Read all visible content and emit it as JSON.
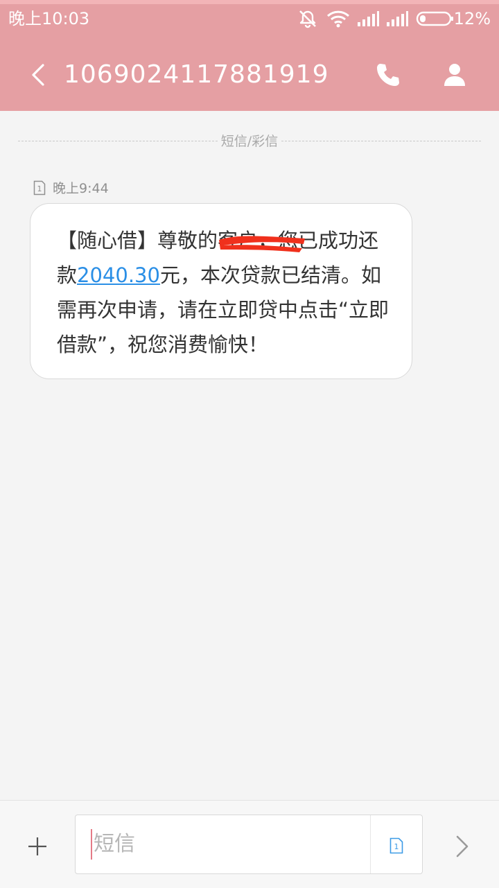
{
  "status_bar": {
    "time": "晚上10:03",
    "battery_percent": "12%"
  },
  "header": {
    "title": "1069024117881919"
  },
  "divider": {
    "label": "短信/彩信"
  },
  "message": {
    "time": "晚上9:44",
    "sim_slot": "1",
    "text_before_amount": "【随心借】尊敬的客户，您已成功还款",
    "amount": "2040.30",
    "text_after_amount": "元，本次贷款已结清。如需再次申请，请在立即贷中点击“立即借款”，祝您消费愉快！"
  },
  "input": {
    "placeholder": "短信",
    "sim_slot": "1"
  },
  "colors": {
    "header_bg": "#e59fa3",
    "link": "#2b8fe6",
    "redaction": "#f0301c"
  },
  "icons": {
    "mute": "mute-icon",
    "wifi": "wifi-icon",
    "signal": "signal-icon",
    "battery": "battery-icon",
    "back": "back-arrow-icon",
    "phone": "phone-icon",
    "person": "person-icon",
    "sim": "sim-card-icon",
    "add": "plus-icon",
    "send": "chevron-right-icon"
  }
}
